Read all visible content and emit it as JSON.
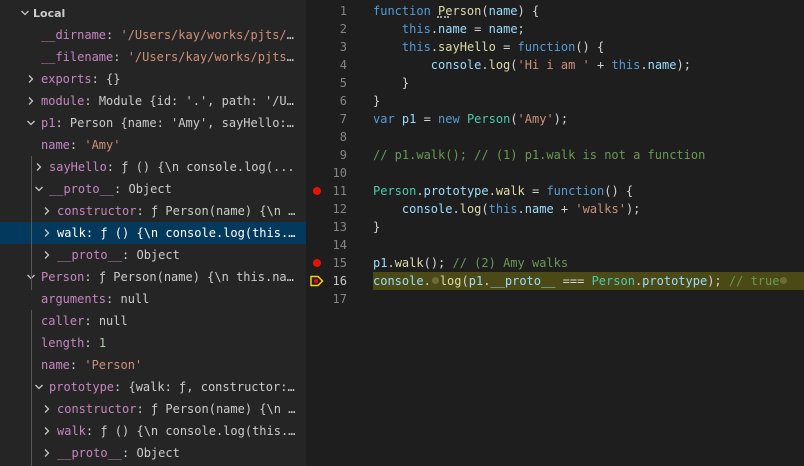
{
  "variables": {
    "section_title": "Local",
    "rows": [
      {
        "key": "__dirname",
        "sep": ": ",
        "value": "'/Users/kay/works/pjts/test/...",
        "vclass": "vs"
      },
      {
        "key": "__filename",
        "sep": ": ",
        "value": "'/Users/kay/works/pjts/test...",
        "vclass": "vs"
      },
      {
        "key": "exports",
        "sep": ": ",
        "value": "{}",
        "vclass": "v"
      },
      {
        "key": "module",
        "sep": ": ",
        "value": "Module {id: '.', path: '/Users/...",
        "vclass": "v"
      },
      {
        "key": "p1",
        "sep": ": ",
        "value": "Person {name: 'Amy', sayHello: ƒ}",
        "vclass": "v"
      },
      {
        "key": "name",
        "sep": ": ",
        "value": "'Amy'",
        "vclass": "vs"
      },
      {
        "key": "sayHello",
        "sep": ": ",
        "value": "ƒ () {\\n        console.log(...",
        "vclass": "v"
      },
      {
        "key": "__proto__",
        "sep": ": ",
        "value": "Object",
        "vclass": "v"
      },
      {
        "key": "constructor",
        "sep": ": ",
        "value": "ƒ Person(name) {\\n     t...",
        "vclass": "v"
      },
      {
        "key": "walk",
        "sep": ": ",
        "value": "ƒ () {\\n    console.log(this.n...",
        "vclass": "v"
      },
      {
        "key": "__proto__",
        "sep": ": ",
        "value": "Object",
        "vclass": "v"
      },
      {
        "key": "Person",
        "sep": ": ",
        "value": "ƒ Person(name) {\\n    this.name...",
        "vclass": "v"
      },
      {
        "key": "arguments",
        "sep": ": ",
        "value": "null",
        "vclass": "v"
      },
      {
        "key": "caller",
        "sep": ": ",
        "value": "null",
        "vclass": "v"
      },
      {
        "key": "length",
        "sep": ": ",
        "value": "1",
        "vclass": "vn"
      },
      {
        "key": "name",
        "sep": ": ",
        "value": "'Person'",
        "vclass": "vs"
      },
      {
        "key": "prototype",
        "sep": ": ",
        "value": "{walk: ƒ, constructor: ƒ}",
        "vclass": "v"
      },
      {
        "key": "constructor",
        "sep": ": ",
        "value": "ƒ Person(name) {\\n    t...",
        "vclass": "v"
      },
      {
        "key": "walk",
        "sep": ": ",
        "value": "ƒ () {\\n    console.log(this.n...",
        "vclass": "v"
      },
      {
        "key": "__proto__",
        "sep": ": ",
        "value": "Object",
        "vclass": "v"
      }
    ]
  },
  "editor": {
    "line_numbers": [
      "1",
      "2",
      "3",
      "4",
      "5",
      "6",
      "7",
      "8",
      "9",
      "10",
      "11",
      "12",
      "13",
      "14",
      "15",
      "16",
      "17"
    ],
    "breakpoint_lines": [
      "11",
      "15"
    ],
    "current_line": "16",
    "lines": [
      [
        {
          "t": "function ",
          "c": "c-kw"
        },
        {
          "t": "Person",
          "c": "c-fn"
        },
        {
          "t": "(",
          "c": "c-op"
        },
        {
          "t": "name",
          "c": "c-id"
        },
        {
          "t": ") {",
          "c": "c-op"
        }
      ],
      [
        {
          "t": "    ",
          "c": "c-op"
        },
        {
          "t": "this",
          "c": "c-kw"
        },
        {
          "t": ".",
          "c": "c-op"
        },
        {
          "t": "name",
          "c": "c-id"
        },
        {
          "t": " = ",
          "c": "c-op"
        },
        {
          "t": "name",
          "c": "c-id"
        },
        {
          "t": ";",
          "c": "c-op"
        }
      ],
      [
        {
          "t": "    ",
          "c": "c-op"
        },
        {
          "t": "this",
          "c": "c-kw"
        },
        {
          "t": ".",
          "c": "c-op"
        },
        {
          "t": "sayHello",
          "c": "c-fn"
        },
        {
          "t": " = ",
          "c": "c-op"
        },
        {
          "t": "function",
          "c": "c-kw"
        },
        {
          "t": "() {",
          "c": "c-op"
        }
      ],
      [
        {
          "t": "        ",
          "c": "c-op"
        },
        {
          "t": "console",
          "c": "c-id"
        },
        {
          "t": ".",
          "c": "c-op"
        },
        {
          "t": "log",
          "c": "c-fn"
        },
        {
          "t": "(",
          "c": "c-op"
        },
        {
          "t": "'Hi i am '",
          "c": "c-str"
        },
        {
          "t": " + ",
          "c": "c-op"
        },
        {
          "t": "this",
          "c": "c-kw"
        },
        {
          "t": ".",
          "c": "c-op"
        },
        {
          "t": "name",
          "c": "c-id"
        },
        {
          "t": ");",
          "c": "c-op"
        }
      ],
      [
        {
          "t": "    }",
          "c": "c-op"
        }
      ],
      [
        {
          "t": "}",
          "c": "c-op"
        }
      ],
      [
        {
          "t": "var ",
          "c": "c-kw"
        },
        {
          "t": "p1",
          "c": "c-id"
        },
        {
          "t": " = ",
          "c": "c-op"
        },
        {
          "t": "new ",
          "c": "c-kw"
        },
        {
          "t": "Person",
          "c": "c-cls"
        },
        {
          "t": "(",
          "c": "c-op"
        },
        {
          "t": "'Amy'",
          "c": "c-str"
        },
        {
          "t": ");",
          "c": "c-op"
        }
      ],
      [],
      [
        {
          "t": "// p1.walk(); // (1) p1.walk is not a function",
          "c": "c-cm"
        }
      ],
      [],
      [
        {
          "t": "Person",
          "c": "c-cls"
        },
        {
          "t": ".",
          "c": "c-op"
        },
        {
          "t": "prototype",
          "c": "c-id"
        },
        {
          "t": ".",
          "c": "c-op"
        },
        {
          "t": "walk",
          "c": "c-fn"
        },
        {
          "t": " = ",
          "c": "c-op"
        },
        {
          "t": "function",
          "c": "c-kw"
        },
        {
          "t": "() {",
          "c": "c-op"
        }
      ],
      [
        {
          "t": "    ",
          "c": "c-op"
        },
        {
          "t": "console",
          "c": "c-id"
        },
        {
          "t": ".",
          "c": "c-op"
        },
        {
          "t": "log",
          "c": "c-fn"
        },
        {
          "t": "(",
          "c": "c-op"
        },
        {
          "t": "this",
          "c": "c-kw"
        },
        {
          "t": ".",
          "c": "c-op"
        },
        {
          "t": "name",
          "c": "c-id"
        },
        {
          "t": " + ",
          "c": "c-op"
        },
        {
          "t": "'walks'",
          "c": "c-str"
        },
        {
          "t": ");",
          "c": "c-op"
        }
      ],
      [
        {
          "t": "}",
          "c": "c-op"
        }
      ],
      [],
      [
        {
          "t": "p1",
          "c": "c-id"
        },
        {
          "t": ".",
          "c": "c-op"
        },
        {
          "t": "walk",
          "c": "c-fn"
        },
        {
          "t": "(); ",
          "c": "c-op"
        },
        {
          "t": "// (2) Amy walks",
          "c": "c-cm"
        }
      ],
      [
        {
          "t": "console",
          "c": "c-id"
        },
        {
          "t": ".",
          "c": "c-op"
        },
        {
          "t": "",
          "c": "ibreak"
        },
        {
          "t": "log",
          "c": "c-fn"
        },
        {
          "t": "(",
          "c": "c-op"
        },
        {
          "t": "p1",
          "c": "c-id"
        },
        {
          "t": ".",
          "c": "c-op"
        },
        {
          "t": "__proto__",
          "c": "c-id"
        },
        {
          "t": " === ",
          "c": "c-op"
        },
        {
          "t": "Person",
          "c": "c-cls"
        },
        {
          "t": ".",
          "c": "c-op"
        },
        {
          "t": "prototype",
          "c": "c-id"
        },
        {
          "t": "); ",
          "c": "c-op"
        },
        {
          "t": "// true",
          "c": "c-cm"
        },
        {
          "t": "",
          "c": "ibreak"
        }
      ],
      []
    ]
  },
  "colors": {
    "panel_bg": "#252526",
    "editor_bg": "#1e1e1e",
    "selection": "#04395e",
    "current_line": "#4b4a17",
    "breakpoint": "#e51400",
    "debug_arrow": "#ffcc00"
  }
}
